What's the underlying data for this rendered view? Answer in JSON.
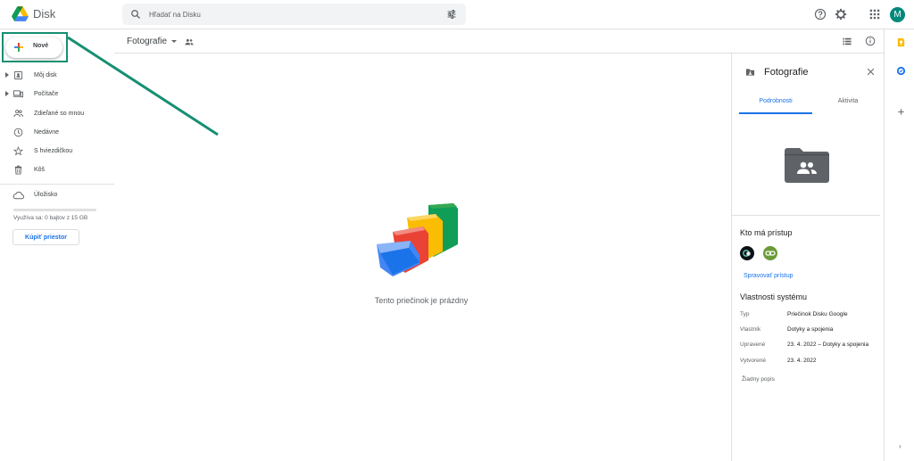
{
  "header": {
    "app_name": "Disk",
    "search_placeholder": "Hľadať na Disku",
    "avatar_letter": "M"
  },
  "sidebar": {
    "new_label": "Nové",
    "items": [
      {
        "label": "Môj disk",
        "icon": "my-drive-icon",
        "expandable": true
      },
      {
        "label": "Počítače",
        "icon": "computers-icon",
        "expandable": true
      },
      {
        "label": "Zdieľané so mnou",
        "icon": "shared-icon",
        "expandable": false
      },
      {
        "label": "Nedávne",
        "icon": "clock-icon",
        "expandable": false
      },
      {
        "label": "S hviezdičkou",
        "icon": "star-icon",
        "expandable": false
      },
      {
        "label": "Kôš",
        "icon": "trash-icon",
        "expandable": false
      }
    ],
    "storage_label": "Úložisko",
    "storage_used_fraction": 0,
    "usage_text": "Využíva sa: 0 bajtov z 15 GB",
    "buy_label": "Kúpiť priestor"
  },
  "toolbar": {
    "folder_title": "Fotografie"
  },
  "main": {
    "empty_text": "Tento priečinok je prázdny"
  },
  "details": {
    "title": "Fotografie",
    "tabs": [
      "Podrobnosti",
      "Aktivita"
    ],
    "access_title": "Kto má prístup",
    "manage_access": "Spravovať prístup",
    "system_title": "Vlastnosti systému",
    "properties": [
      {
        "key": "Typ",
        "value": "Priečinok Disku Google"
      },
      {
        "key": "Vlastník",
        "value": "Dotyky a spojenia"
      },
      {
        "key": "Upravené",
        "value": "23. 4. 2022 – Dotyky a spojenia"
      },
      {
        "key": "Vytvorené",
        "value": "23. 4. 2022"
      }
    ],
    "no_description": "Žiadny popis"
  },
  "colors": {
    "accent": "#1a73e8",
    "highlight": "#168f72",
    "avatar": "#00897b"
  }
}
